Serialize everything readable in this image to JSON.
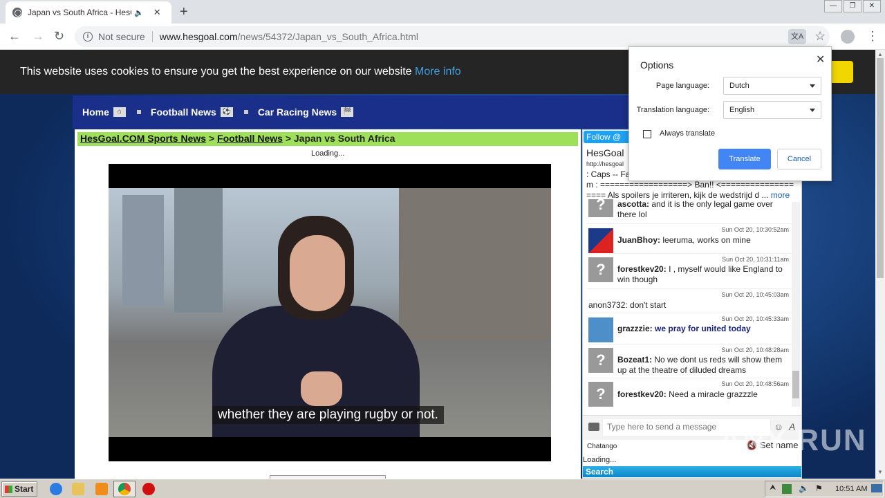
{
  "browser": {
    "tab_title": "Japan vs South Africa - HesGoal",
    "audio_icon": "speaker-icon",
    "new_tab_symbol": "+",
    "not_secure": "Not secure",
    "url_host": "www.hesgoal.com",
    "url_path": "/news/54372/Japan_vs_South_Africa.html"
  },
  "cookie_banner": {
    "text": "This website uses cookies to ensure you get the best experience on our website",
    "more_info": "More info"
  },
  "site_nav": {
    "items": [
      {
        "label": "Home"
      },
      {
        "label": "Football News"
      },
      {
        "label": "Car Racing News"
      }
    ]
  },
  "breadcrumb": {
    "home": "HesGoal.COM Sports News",
    "section": "Football News",
    "sep": ">",
    "current": "Japan vs South Africa"
  },
  "video": {
    "loading": "Loading...",
    "subtitle": "whether they are playing rugby or not."
  },
  "chat": {
    "follow": "Follow @",
    "title": "HesGoal",
    "url": "http://hesgoal",
    "desc_line1": ": Caps -- Fa",
    "desc_line2": "m : ==================> Ban!! <===============",
    "desc_line3": "==== Als spoilers je irriteren, kijk de wedstrijd d ...",
    "more": "more",
    "messages": [
      {
        "ts": "",
        "user": "ascotta:",
        "text": "and it is the only legal game over there lol",
        "avatar": "?"
      },
      {
        "ts": "Sun Oct 20, 10:30:52am",
        "user": "JuanBhoy:",
        "text": "leeruma, works on mine",
        "avatar": "flag"
      },
      {
        "ts": "Sun Oct 20, 10:31:11am",
        "user": "forestkev20:",
        "text": "I , myself would like England to win though",
        "avatar": "?"
      },
      {
        "ts": "Sun Oct 20, 10:45:03am",
        "user": "",
        "text": "anon3732: don't start",
        "avatar": ""
      },
      {
        "ts": "Sun Oct 20, 10:45:33am",
        "user": "grazzzie:",
        "text": "we pray for united today",
        "avatar": "photo"
      },
      {
        "ts": "Sun Oct 20, 10:48:28am",
        "user": "Bozeat1:",
        "text": "No we dont us reds will show them up at the theatre of diluded dreams",
        "avatar": "?"
      },
      {
        "ts": "Sun Oct 20, 10:48:56am",
        "user": "forestkev20:",
        "text": "Need a miracle grazzzle",
        "avatar": "?"
      }
    ],
    "input_placeholder": "Type here to send a message",
    "brand": "Chatango",
    "set_name": "Set name",
    "loading": "Loading...",
    "search": "Search"
  },
  "translate_popup": {
    "title": "Options",
    "page_language_label": "Page language:",
    "page_language": "Dutch",
    "translation_language_label": "Translation language:",
    "translation_language": "English",
    "always_translate": "Always translate",
    "translate_btn": "Translate",
    "cancel_btn": "Cancel"
  },
  "watermark": "ANY RUN",
  "taskbar": {
    "start": "Start",
    "clock": "10:51 AM"
  }
}
